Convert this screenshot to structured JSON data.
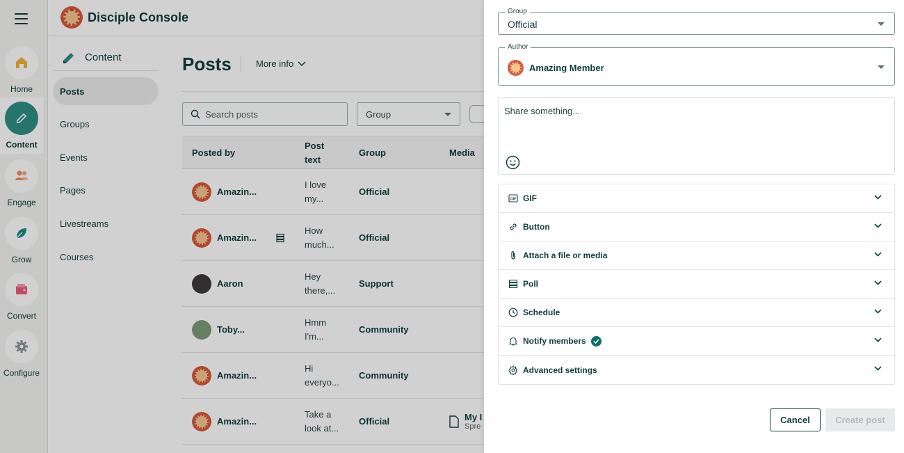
{
  "rail": {
    "items": [
      {
        "label": "Home"
      },
      {
        "label": "Content"
      },
      {
        "label": "Engage"
      },
      {
        "label": "Grow"
      },
      {
        "label": "Convert"
      },
      {
        "label": "Configure"
      }
    ]
  },
  "app": {
    "title": "Disciple Console"
  },
  "subnav": {
    "heading": "Content",
    "items": [
      {
        "label": "Posts"
      },
      {
        "label": "Groups"
      },
      {
        "label": "Events"
      },
      {
        "label": "Pages"
      },
      {
        "label": "Livestreams"
      },
      {
        "label": "Courses"
      }
    ]
  },
  "main": {
    "title": "Posts",
    "more_info": "More info",
    "search_placeholder": "Search posts",
    "group_filter": "Group",
    "columns": [
      "Posted by",
      "Post text",
      "Group",
      "Media"
    ],
    "rows": [
      {
        "name": "Amazin...",
        "text": "I love my...",
        "group": "Official",
        "media_title": "",
        "media_sub": ""
      },
      {
        "name": "Amazin...",
        "text": "How much...",
        "group": "Official",
        "media_title": "",
        "media_sub": ""
      },
      {
        "name": "Aaron",
        "text": "Hey there,...",
        "group": "Support",
        "media_title": "",
        "media_sub": ""
      },
      {
        "name": "Toby...",
        "text": "Hmm I'm...",
        "group": "Community",
        "media_title": "",
        "media_sub": ""
      },
      {
        "name": "Amazin...",
        "text": "Hi everyo...",
        "group": "Community",
        "media_title": "",
        "media_sub": ""
      },
      {
        "name": "Amazin...",
        "text": "Take a look at...",
        "group": "Official",
        "media_title": "My I",
        "media_sub": "Spre"
      }
    ]
  },
  "drawer": {
    "group_label": "Group",
    "group_value": "Official",
    "author_label": "Author",
    "author_value": "Amazing Member",
    "compose_placeholder": "Share something...",
    "sections": [
      {
        "label": "GIF"
      },
      {
        "label": "Button"
      },
      {
        "label": "Attach a file or media"
      },
      {
        "label": "Poll"
      },
      {
        "label": "Schedule"
      },
      {
        "label": "Notify members"
      },
      {
        "label": "Advanced settings"
      }
    ],
    "cancel": "Cancel",
    "create": "Create post"
  },
  "colors": {
    "brand": "#0f3d3e",
    "accent": "#2e8f86",
    "logo": "#d95a3a"
  },
  "icons": [
    "hamburger-icon",
    "home-icon",
    "pencil-icon",
    "people-icon",
    "leaf-icon",
    "wallet-icon",
    "gear-icon",
    "search-icon",
    "calendar-icon",
    "emoji-icon",
    "gif-icon",
    "link-icon",
    "paperclip-icon",
    "poll-icon",
    "clock-icon",
    "bell-icon",
    "check-icon",
    "settings-icon",
    "chevron-down-icon",
    "document-icon"
  ]
}
